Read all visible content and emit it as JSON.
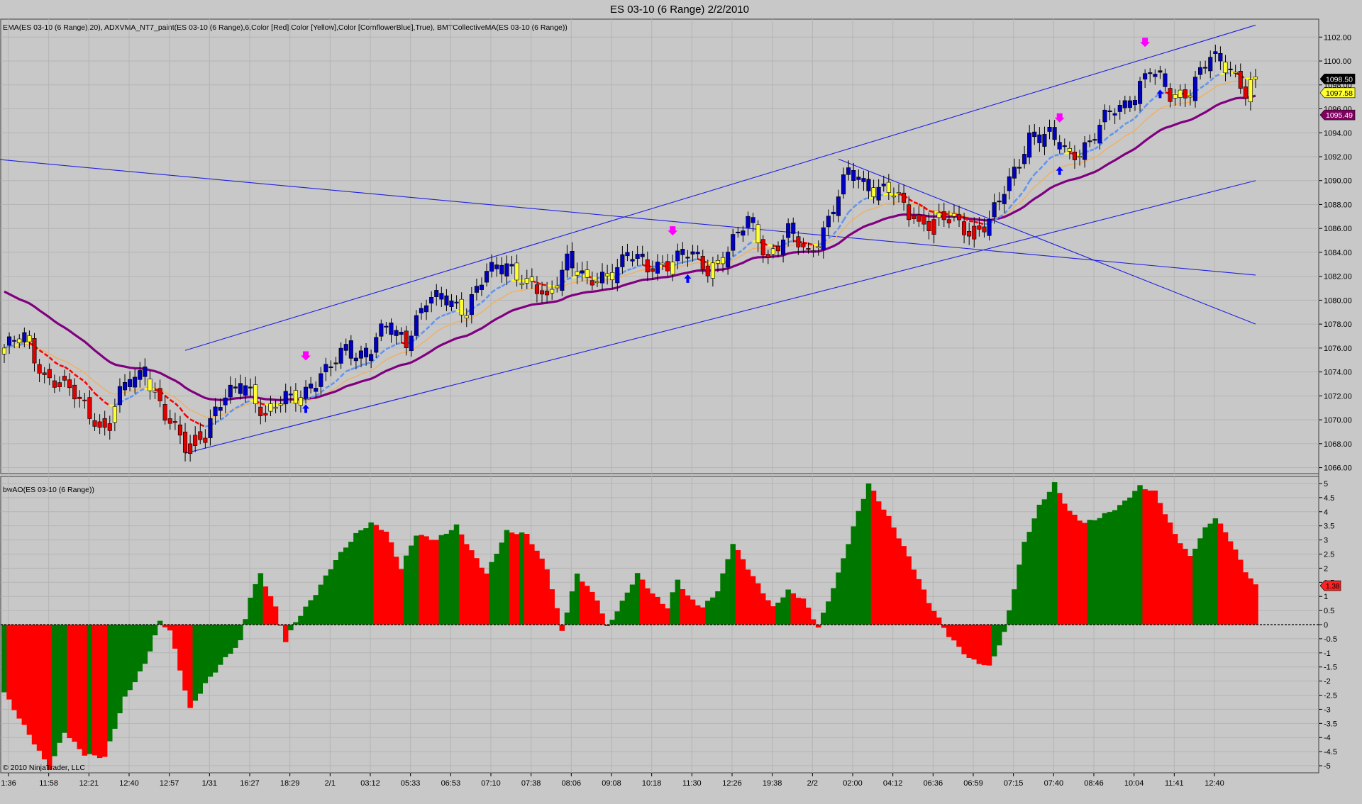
{
  "window": {
    "title": "ES 03-10 (6 Range)  2/2/2010"
  },
  "price_panel": {
    "indicator_label": "EMA(ES 03-10 (6 Range),20), ADXVMA_NT7_paint(ES 03-10 (6 Range),6,Color [Red],Color [Yellow],Color [CornflowerBlue],True), BMTCollectiveMA(ES 03-10 (6 Range))",
    "y_ticks": [
      "1102.00",
      "1100.00",
      "1098.00",
      "1096.00",
      "1094.00",
      "1092.00",
      "1090.00",
      "1088.00",
      "1086.00",
      "1084.00",
      "1082.00",
      "1080.00",
      "1078.00",
      "1076.00",
      "1074.00",
      "1072.00",
      "1070.00",
      "1068.00",
      "1066.00"
    ],
    "price_tags": [
      {
        "label": "1098.50",
        "value": 1098.5,
        "bg": "#000000",
        "fg": "#ffffff"
      },
      {
        "label": "1097.58",
        "value": 1097.58,
        "bg": "#ffff33",
        "fg": "#000000"
      },
      {
        "label": "1095.49",
        "value": 1095.49,
        "bg": "#800060",
        "fg": "#ffffff"
      }
    ]
  },
  "ao_panel": {
    "indicator_label": "bwAO(ES 03-10 (6 Range))",
    "y_ticks": [
      "5",
      "4.5",
      "4",
      "3.5",
      "3",
      "2.5",
      "2",
      "1.5",
      "1",
      "0.5",
      "0",
      "-0.5",
      "-1",
      "-1.5",
      "-2",
      "-2.5",
      "-3",
      "-3.5",
      "-4",
      "-4.5",
      "-5"
    ],
    "value_tag": {
      "label": "1.38",
      "value": 1.38,
      "bg": "#ff2020",
      "fg": "#000000"
    }
  },
  "x_axis": {
    "ticks": [
      "1:36",
      "11:58",
      "12:21",
      "12:40",
      "12:57",
      "1/31",
      "16:27",
      "18:29",
      "2/1",
      "03:12",
      "05:33",
      "06:53",
      "07:10",
      "07:38",
      "08:06",
      "09:08",
      "10:18",
      "11:30",
      "12:26",
      "19:38",
      "2/2",
      "02:00",
      "04:12",
      "06:36",
      "06:59",
      "07:15",
      "07:40",
      "08:46",
      "10:04",
      "11:41",
      "12:40"
    ]
  },
  "copyright": "© 2010 NinjaTrader, LLC",
  "colors": {
    "background": "#c8c8c8",
    "up_blue": "#0000c0",
    "neutral_yellow": "#ffff33",
    "down_red": "#e00000",
    "ema": "#f0b060",
    "collective_ma": "#800080",
    "adx_blue": "#6495ed",
    "adx_yellow": "#ffff00",
    "adx_red": "#ff0000",
    "trendline": "#2020e0",
    "ao_green": "#007800",
    "ao_red": "#ff0000",
    "arrow_magenta": "#ff00ff",
    "arrow_blue": "#0000ff"
  },
  "chart_data": [
    {
      "type": "candlestick",
      "title": "ES 03-10 (6 Range)  2/2/2010",
      "ylim": [
        1065.5,
        1103.5
      ],
      "anchors": [
        {
          "i": 0,
          "c": 1076
        },
        {
          "i": 4,
          "c": 1076.8
        },
        {
          "i": 8,
          "c": 1073.8
        },
        {
          "i": 12,
          "c": 1072.8
        },
        {
          "i": 16,
          "c": 1071.2
        },
        {
          "i": 20,
          "c": 1069.2
        },
        {
          "i": 24,
          "c": 1072.8
        },
        {
          "i": 28,
          "c": 1074.2
        },
        {
          "i": 32,
          "c": 1070.2
        },
        {
          "i": 36,
          "c": 1067.8
        },
        {
          "i": 40,
          "c": 1069.2
        },
        {
          "i": 44,
          "c": 1071.8
        },
        {
          "i": 48,
          "c": 1073.2
        },
        {
          "i": 52,
          "c": 1070.2
        },
        {
          "i": 56,
          "c": 1071.8
        },
        {
          "i": 60,
          "c": 1072.5
        },
        {
          "i": 64,
          "c": 1073.8
        },
        {
          "i": 68,
          "c": 1076.2
        },
        {
          "i": 72,
          "c": 1075.2
        },
        {
          "i": 76,
          "c": 1077.8
        },
        {
          "i": 80,
          "c": 1076.8
        },
        {
          "i": 84,
          "c": 1079.8
        },
        {
          "i": 88,
          "c": 1080.2
        },
        {
          "i": 92,
          "c": 1079.2
        },
        {
          "i": 96,
          "c": 1082.2
        },
        {
          "i": 100,
          "c": 1083.2
        },
        {
          "i": 104,
          "c": 1081.2
        },
        {
          "i": 108,
          "c": 1080.2
        },
        {
          "i": 112,
          "c": 1083.6
        },
        {
          "i": 116,
          "c": 1081.2
        },
        {
          "i": 120,
          "c": 1082.2
        },
        {
          "i": 124,
          "c": 1083.8
        },
        {
          "i": 128,
          "c": 1082.6
        },
        {
          "i": 132,
          "c": 1083.3
        },
        {
          "i": 136,
          "c": 1083.8
        },
        {
          "i": 140,
          "c": 1082.6
        },
        {
          "i": 144,
          "c": 1084.2
        },
        {
          "i": 148,
          "c": 1086.6
        },
        {
          "i": 152,
          "c": 1083.8
        },
        {
          "i": 156,
          "c": 1085.6
        },
        {
          "i": 160,
          "c": 1083.8
        },
        {
          "i": 164,
          "c": 1086.8
        },
        {
          "i": 168,
          "c": 1090.6
        },
        {
          "i": 172,
          "c": 1089.6
        },
        {
          "i": 176,
          "c": 1089.2
        },
        {
          "i": 180,
          "c": 1087.2
        },
        {
          "i": 184,
          "c": 1086.6
        },
        {
          "i": 188,
          "c": 1086.8
        },
        {
          "i": 192,
          "c": 1085.8
        },
        {
          "i": 196,
          "c": 1086.6
        },
        {
          "i": 200,
          "c": 1089.8
        },
        {
          "i": 204,
          "c": 1093.8
        },
        {
          "i": 208,
          "c": 1093.6
        },
        {
          "i": 212,
          "c": 1092.2
        },
        {
          "i": 216,
          "c": 1093.2
        },
        {
          "i": 220,
          "c": 1095.6
        },
        {
          "i": 224,
          "c": 1096.8
        },
        {
          "i": 228,
          "c": 1099.2
        },
        {
          "i": 232,
          "c": 1097.2
        },
        {
          "i": 236,
          "c": 1097.6
        },
        {
          "i": 240,
          "c": 1100.2
        },
        {
          "i": 244,
          "c": 1099.6
        },
        {
          "i": 247,
          "c": 1097.4
        },
        {
          "i": 249,
          "c": 1098.5
        }
      ],
      "ema20_last": 1097.58,
      "collective_ma_last": 1095.49
    },
    {
      "type": "bar",
      "title": "bwAO(ES 03-10 (6 Range))",
      "ylim": [
        -5.25,
        5.25
      ],
      "anchors": [
        {
          "i": 0,
          "v": -2.4
        },
        {
          "i": 4,
          "v": -3.6
        },
        {
          "i": 9,
          "v": -5.1
        },
        {
          "i": 12,
          "v": -3.8
        },
        {
          "i": 16,
          "v": -4.6
        },
        {
          "i": 20,
          "v": -4.7
        },
        {
          "i": 24,
          "v": -2.6
        },
        {
          "i": 28,
          "v": -1.4
        },
        {
          "i": 31,
          "v": 0.1
        },
        {
          "i": 33,
          "v": -0.2
        },
        {
          "i": 37,
          "v": -3.0
        },
        {
          "i": 40,
          "v": -2.1
        },
        {
          "i": 44,
          "v": -1.2
        },
        {
          "i": 47,
          "v": -0.6
        },
        {
          "i": 49,
          "v": 1.0
        },
        {
          "i": 51,
          "v": 1.8
        },
        {
          "i": 54,
          "v": 0.6
        },
        {
          "i": 56,
          "v": -0.6
        },
        {
          "i": 58,
          "v": 0.1
        },
        {
          "i": 62,
          "v": 1.1
        },
        {
          "i": 66,
          "v": 2.3
        },
        {
          "i": 70,
          "v": 3.2
        },
        {
          "i": 73,
          "v": 3.6
        },
        {
          "i": 76,
          "v": 3.3
        },
        {
          "i": 79,
          "v": 2.0
        },
        {
          "i": 82,
          "v": 3.2
        },
        {
          "i": 86,
          "v": 3.0
        },
        {
          "i": 90,
          "v": 3.5
        },
        {
          "i": 93,
          "v": 2.6
        },
        {
          "i": 96,
          "v": 1.8
        },
        {
          "i": 100,
          "v": 3.3
        },
        {
          "i": 104,
          "v": 3.2
        },
        {
          "i": 108,
          "v": 2.0
        },
        {
          "i": 111,
          "v": -0.2
        },
        {
          "i": 114,
          "v": 1.8
        },
        {
          "i": 118,
          "v": 0.9
        },
        {
          "i": 120,
          "v": -0.1
        },
        {
          "i": 123,
          "v": 0.8
        },
        {
          "i": 126,
          "v": 1.8
        },
        {
          "i": 129,
          "v": 1.1
        },
        {
          "i": 132,
          "v": 0.6
        },
        {
          "i": 134,
          "v": 1.6
        },
        {
          "i": 136,
          "v": 1.0
        },
        {
          "i": 139,
          "v": 0.6
        },
        {
          "i": 142,
          "v": 1.2
        },
        {
          "i": 145,
          "v": 2.9
        },
        {
          "i": 149,
          "v": 1.7
        },
        {
          "i": 153,
          "v": 0.6
        },
        {
          "i": 156,
          "v": 1.2
        },
        {
          "i": 159,
          "v": 0.9
        },
        {
          "i": 162,
          "v": -0.1
        },
        {
          "i": 166,
          "v": 1.8
        },
        {
          "i": 170,
          "v": 4.0
        },
        {
          "i": 172,
          "v": 5.0
        },
        {
          "i": 176,
          "v": 3.8
        },
        {
          "i": 180,
          "v": 2.4
        },
        {
          "i": 184,
          "v": 0.8
        },
        {
          "i": 188,
          "v": -0.4
        },
        {
          "i": 192,
          "v": -1.2
        },
        {
          "i": 196,
          "v": -1.5
        },
        {
          "i": 199,
          "v": -0.3
        },
        {
          "i": 203,
          "v": 2.9
        },
        {
          "i": 206,
          "v": 4.2
        },
        {
          "i": 209,
          "v": 5.0
        },
        {
          "i": 212,
          "v": 4.0
        },
        {
          "i": 215,
          "v": 3.6
        },
        {
          "i": 218,
          "v": 3.8
        },
        {
          "i": 222,
          "v": 4.2
        },
        {
          "i": 226,
          "v": 4.9
        },
        {
          "i": 229,
          "v": 4.7
        },
        {
          "i": 233,
          "v": 3.2
        },
        {
          "i": 236,
          "v": 2.4
        },
        {
          "i": 239,
          "v": 3.4
        },
        {
          "i": 241,
          "v": 3.8
        },
        {
          "i": 244,
          "v": 3.0
        },
        {
          "i": 247,
          "v": 1.9
        },
        {
          "i": 249,
          "v": 1.38
        }
      ]
    }
  ]
}
